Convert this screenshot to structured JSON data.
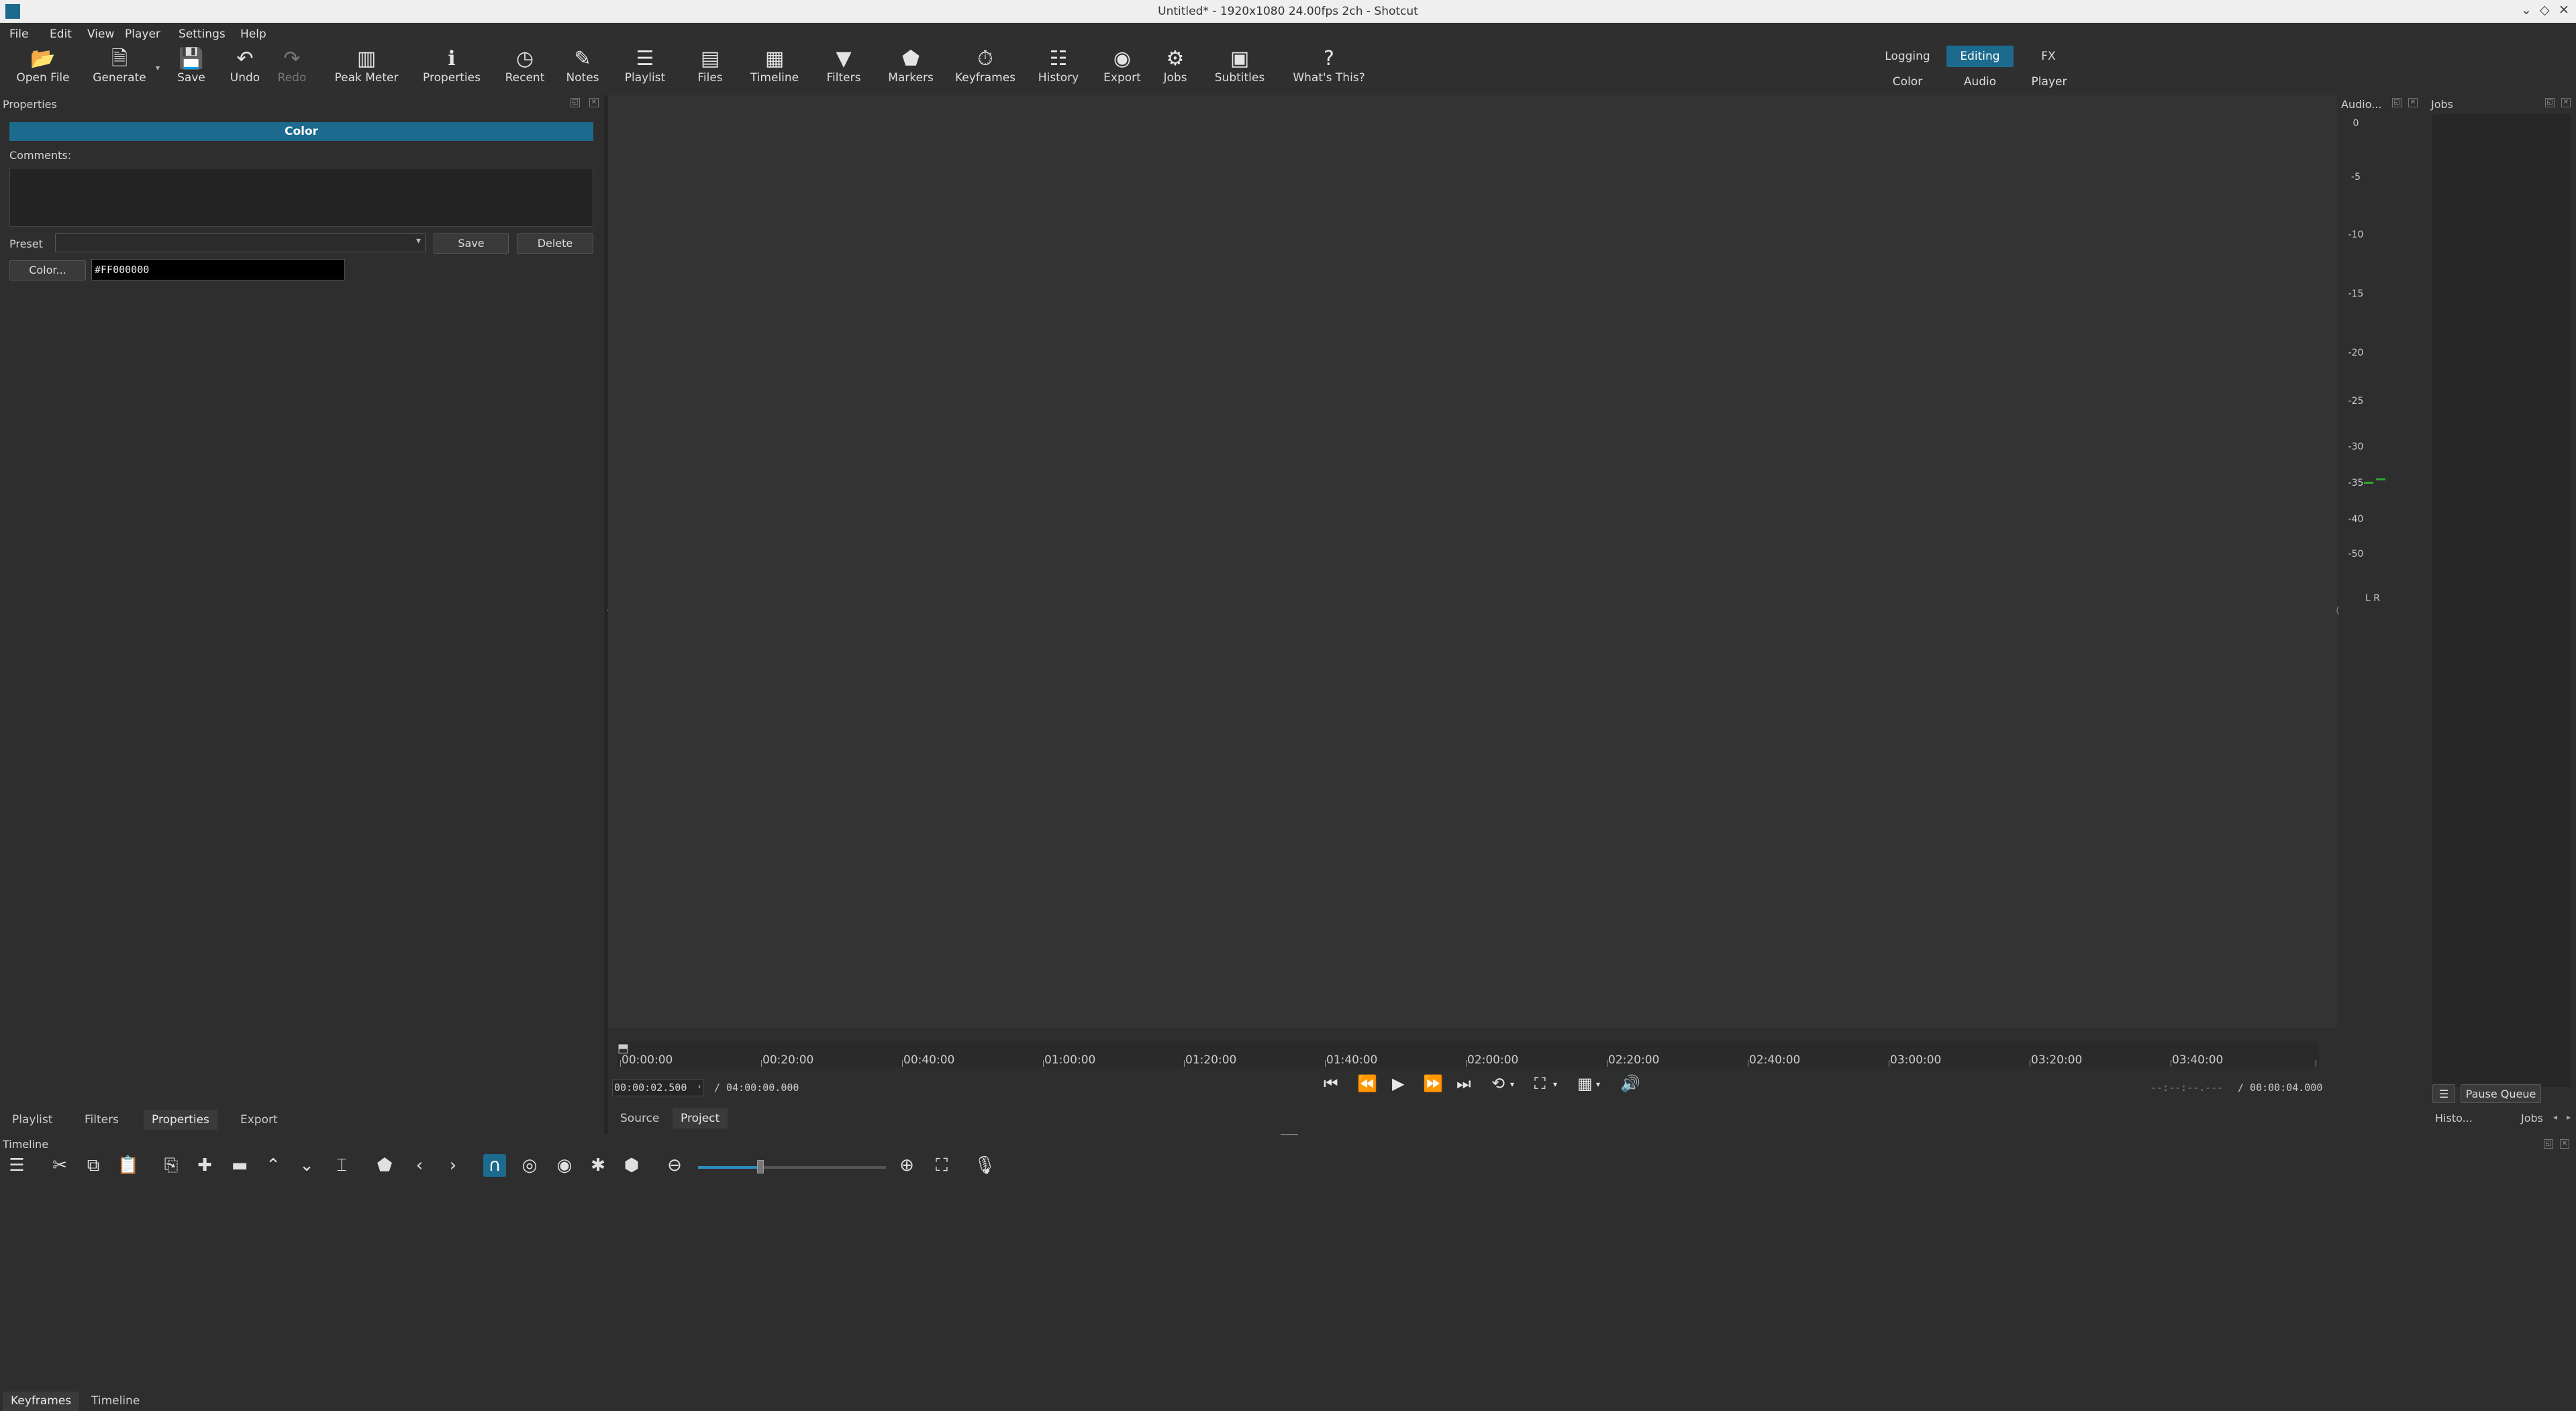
{
  "window": {
    "title": "Untitled* - 1920x1080 24.00fps 2ch - Shotcut",
    "controls": [
      "⌄",
      "◇",
      "✕"
    ]
  },
  "menu": [
    "File",
    "Edit",
    "View",
    "Player",
    "Settings",
    "Help"
  ],
  "toolbar": [
    {
      "label": "Open File",
      "icon": "folder-icon",
      "glyph": "📂",
      "enabled": true
    },
    {
      "label": "Generate",
      "icon": "generate-icon",
      "glyph": "🗎",
      "enabled": true
    },
    {
      "label": "Save",
      "icon": "save-icon",
      "glyph": "💾",
      "enabled": true
    },
    {
      "label": "Undo",
      "icon": "undo-icon",
      "glyph": "↶",
      "enabled": true
    },
    {
      "label": "Redo",
      "icon": "redo-icon",
      "glyph": "↷",
      "enabled": false
    },
    {
      "label": "Peak Meter",
      "icon": "peak-meter-icon",
      "glyph": "▥",
      "enabled": true
    },
    {
      "label": "Properties",
      "icon": "info-icon",
      "glyph": "ℹ",
      "enabled": true
    },
    {
      "label": "Recent",
      "icon": "clock-icon",
      "glyph": "◷",
      "enabled": true
    },
    {
      "label": "Notes",
      "icon": "notes-icon",
      "glyph": "✎",
      "enabled": true
    },
    {
      "label": "Playlist",
      "icon": "list-icon",
      "glyph": "☰",
      "enabled": true
    },
    {
      "label": "Files",
      "icon": "files-icon",
      "glyph": "▤",
      "enabled": true
    },
    {
      "label": "Timeline",
      "icon": "timeline-icon",
      "glyph": "▦",
      "enabled": true
    },
    {
      "label": "Filters",
      "icon": "funnel-icon",
      "glyph": "▼",
      "enabled": true
    },
    {
      "label": "Markers",
      "icon": "marker-icon",
      "glyph": "⬟",
      "enabled": true
    },
    {
      "label": "Keyframes",
      "icon": "stopwatch-icon",
      "glyph": "⏱",
      "enabled": true
    },
    {
      "label": "History",
      "icon": "history-icon",
      "glyph": "☷",
      "enabled": true
    },
    {
      "label": "Export",
      "icon": "export-icon",
      "glyph": "◉",
      "enabled": true
    },
    {
      "label": "Jobs",
      "icon": "gear-icon",
      "glyph": "⚙",
      "enabled": true
    },
    {
      "label": "Subtitles",
      "icon": "subtitles-icon",
      "glyph": "▣",
      "enabled": true
    },
    {
      "label": "What's This?",
      "icon": "help-icon",
      "glyph": "?",
      "enabled": true
    }
  ],
  "layouts": {
    "row1": [
      "Logging",
      "Editing",
      "FX"
    ],
    "row2": [
      "Color",
      "Audio",
      "Player"
    ],
    "active": "Editing"
  },
  "properties": {
    "panel_title": "Properties",
    "header": "Color",
    "comments_label": "Comments:",
    "comments_value": "",
    "preset_label": "Preset",
    "preset_value": "",
    "save_label": "Save",
    "delete_label": "Delete",
    "color_button": "Color...",
    "color_value": "#FF000000"
  },
  "left_tabs": [
    "Playlist",
    "Filters",
    "Properties",
    "Export"
  ],
  "left_tabs_active": "Properties",
  "ruler": {
    "labels": [
      "00:00:00",
      "00:20:00",
      "00:40:00",
      "01:00:00",
      "01:20:00",
      "01:40:00",
      "02:00:00",
      "02:20:00",
      "02:40:00",
      "03:00:00",
      "03:20:00",
      "03:40:00"
    ]
  },
  "player": {
    "current_tc": "00:00:02.500",
    "total_tc": "/ 04:00:00.000",
    "in_tc": "--:--:--.---",
    "out_tc": "/ 00:00:04.000",
    "tabs": [
      "Source",
      "Project"
    ],
    "active_tab": "Project"
  },
  "audio": {
    "title": "Audio...",
    "scale": [
      "0",
      "-5",
      "-10",
      "-15",
      "-20",
      "-25",
      "-30",
      "-35",
      "-40",
      "-50"
    ],
    "channels": "L R",
    "meter_color": "#2fa82f"
  },
  "jobs": {
    "title": "Jobs",
    "menu_icon": "☰",
    "pause_label": "Pause Queue"
  },
  "right_tabs": [
    "Histo...",
    "Jobs"
  ],
  "timeline": {
    "title": "Timeline"
  },
  "bottom_tabs": [
    "Keyframes",
    "Timeline"
  ],
  "bottom_tabs_active": "Keyframes"
}
